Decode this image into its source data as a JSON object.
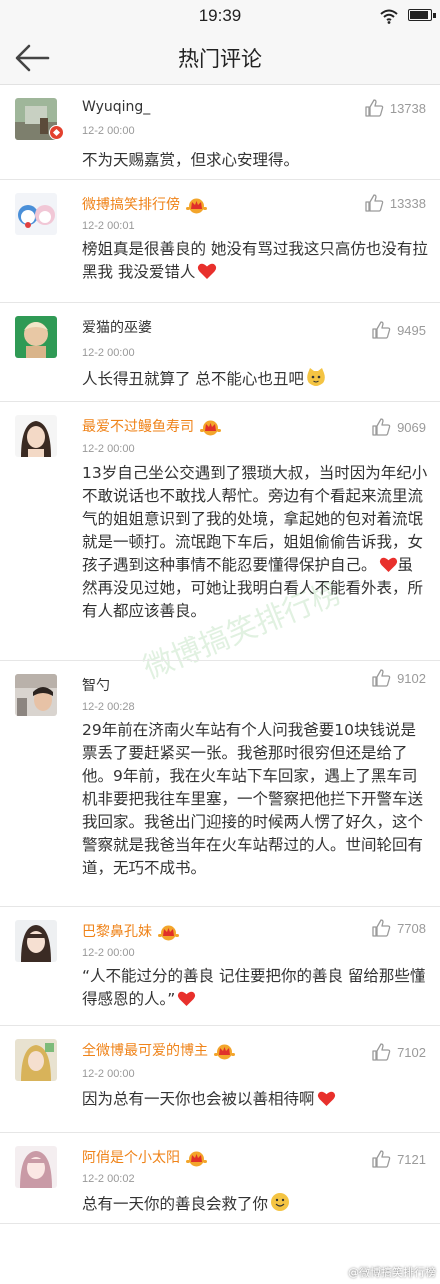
{
  "status": {
    "time": "19:39"
  },
  "nav": {
    "title": "热门评论"
  },
  "comments": [
    {
      "user": "Wyuqing_",
      "time": "12-2 00:00",
      "likes": "13738",
      "text": "不为天赐嘉赏，但求心安理得。"
    },
    {
      "user": "微搏搞笑排行傍",
      "time": "12-2 00:01",
      "likes": "13338",
      "text": "榜姐真是很善良的 她没有骂过我这只高仿也没有拉黑我 我没爱错人"
    },
    {
      "user": "爱猫的巫婆",
      "time": "12-2 00:00",
      "likes": "9495",
      "text": "人长得丑就算了 总不能心也丑吧"
    },
    {
      "user": "最爱不过鳗鱼寿司",
      "time": "12-2 00:00",
      "likes": "9069",
      "text_a": "13岁自己坐公交遇到了猥琐大叔，当时因为年纪小不敢说话也不敢找人帮忙。旁边有个看起来流里流气的姐姐意识到了我的处境，拿起她的包对着流氓就是一顿打。流氓跑下车后，姐姐偷偷告诉我，女孩子遇到这种事情不能忍要懂得保护自己。",
      "text_b": "虽然再没见过她，可她让我明白看人不能看外表，所有人都应该善良。"
    },
    {
      "user": "智勺",
      "time": "12-2 00:28",
      "likes": "9102",
      "text": "29年前在济南火车站有个人问我爸要10块钱说是票丢了要赶紧买一张。我爸那时很穷但还是给了他。9年前，我在火车站下车回家，遇上了黑车司机非要把我往车里塞，一个警察把他拦下开警车送我回家。我爸出门迎接的时候两人愣了好久，这个警察就是我爸当年在火车站帮过的人。世间轮回有道，无巧不成书。"
    },
    {
      "user": "巴黎鼻孔妹",
      "time": "12-2 00:00",
      "likes": "7708",
      "text": "“人不能过分的善良 记住要把你的善良  留给那些懂得感恩的人。”"
    },
    {
      "user": "全微博最可爱的博主",
      "time": "12-2 00:00",
      "likes": "7102",
      "text": "因为总有一天你也会被以善相待啊"
    },
    {
      "user": "阿俏是个小太阳",
      "time": "12-2 00:02",
      "likes": "7121",
      "text": "总有一天你的善良会救了你"
    }
  ],
  "watermark": "@微博搞笑排行榜",
  "bg_watermark": "微博搞笑排行榜",
  "colors": {
    "vip_name": "#ef8319",
    "heart": "#e8302c",
    "vbadge": "#e3412e"
  }
}
